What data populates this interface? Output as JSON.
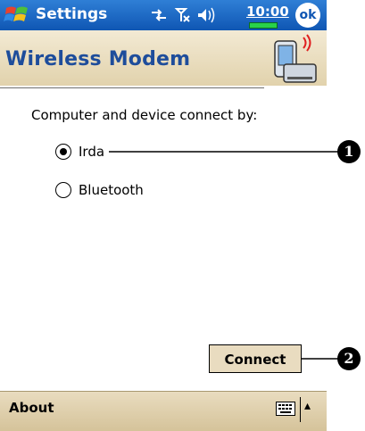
{
  "titlebar": {
    "app_title": "Settings",
    "clock": "10:00",
    "ok_label": "ok",
    "icons": [
      "windows-start-icon",
      "connectivity-icon",
      "antenna-icon",
      "speaker-icon",
      "battery-icon"
    ]
  },
  "header": {
    "title": "Wireless Modem",
    "icon": "wireless-modem-device-icon"
  },
  "body": {
    "prompt": "Computer and device connect by:",
    "options": [
      {
        "label": "Irda",
        "selected": true
      },
      {
        "label": "Bluetooth",
        "selected": false
      }
    ],
    "connect_label": "Connect"
  },
  "menubar": {
    "about_label": "About",
    "keyboard_icon": "keyboard-icon",
    "arrow": "▴"
  },
  "callouts": {
    "first": "1",
    "second": "2"
  },
  "colors": {
    "titlebar": "#0f56b3",
    "header_text": "#1e4d9b",
    "button_fill": "#e9dcc0",
    "menubar": "#d5c39a"
  }
}
